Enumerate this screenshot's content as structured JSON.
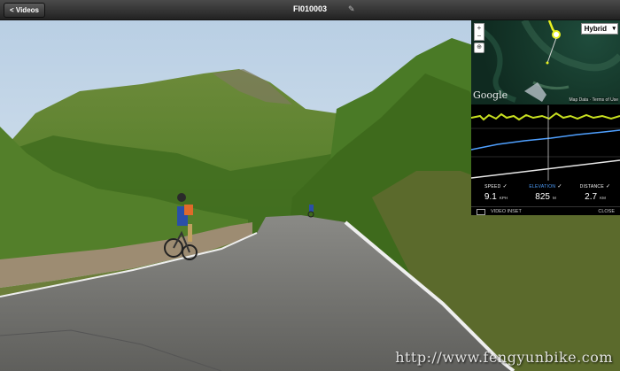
{
  "topbar": {
    "back_label": "< Videos",
    "title": "FI010003",
    "edit_icon": "pencil-icon"
  },
  "map": {
    "zoom_in": "+",
    "zoom_out": "−",
    "maptype": "Hybrid",
    "logo": "Google",
    "attribution": "Map Data · Terms of Use"
  },
  "stats": {
    "speed": {
      "label": "SPEED",
      "value": "9.1",
      "unit": "KPH"
    },
    "elevation": {
      "label": "ELEVATION",
      "value": "825",
      "unit": "M"
    },
    "distance": {
      "label": "DISTANCE",
      "value": "2.7",
      "unit": "KM"
    }
  },
  "inset": {
    "label": "VIDEO INSET",
    "close": "CLOSE"
  },
  "watermark": "http://www.fengyunbike.com",
  "colors": {
    "elevation_accent": "#4fa0ff",
    "speed_trace": "#c8e020",
    "route": "#e8f020"
  }
}
